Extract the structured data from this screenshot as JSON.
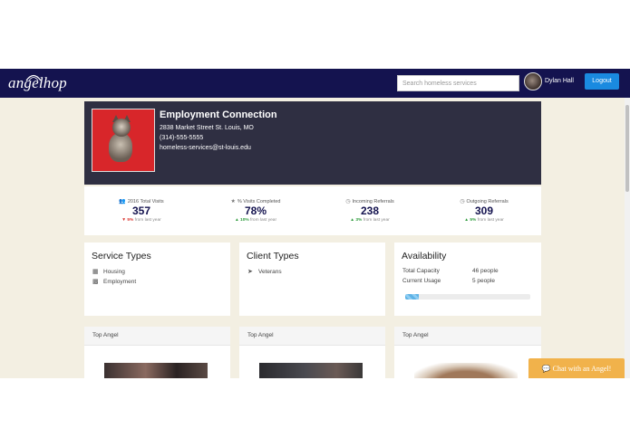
{
  "nav": {
    "logo": "angelhop",
    "search_placeholder": "Search homeless services",
    "user_name": "Dylan Hall",
    "logout": "Logout"
  },
  "profile": {
    "name": "Employment Connection",
    "address": "2838 Market Street St. Louis, MO",
    "phone": "(314)-555-5555",
    "email": "homeless-services@st-louis.edu"
  },
  "stats": [
    {
      "icon": "users-icon",
      "label": "2016 Total Visits",
      "value": "357",
      "direction": "down",
      "change": "5%",
      "suffix": "from last year"
    },
    {
      "icon": "star-icon",
      "label": "% Visits Completed",
      "value": "78%",
      "direction": "up",
      "change": "10%",
      "suffix": "from last year"
    },
    {
      "icon": "clock-icon",
      "label": "Incoming Referrals",
      "value": "238",
      "direction": "up",
      "change": "3%",
      "suffix": "from last year"
    },
    {
      "icon": "clock-icon",
      "label": "Outgoing Referrals",
      "value": "309",
      "direction": "up",
      "change": "5%",
      "suffix": "from last year"
    }
  ],
  "service_types": {
    "title": "Service Types",
    "items": [
      {
        "icon": "building-icon",
        "label": "Housing"
      },
      {
        "icon": "briefcase-icon",
        "label": "Employment"
      }
    ]
  },
  "client_types": {
    "title": "Client Types",
    "items": [
      {
        "icon": "plane-icon",
        "label": "Veterans"
      }
    ]
  },
  "availability": {
    "title": "Availability",
    "capacity_label": "Total Capacity",
    "capacity_value": "46 people",
    "usage_label": "Current Usage",
    "usage_value": "5 people",
    "usage_fraction": 0.11
  },
  "angels": [
    {
      "label": "Top Angel"
    },
    {
      "label": "Top Angel"
    },
    {
      "label": "Top Angel"
    }
  ],
  "chat": {
    "label": "Chat with an Angel!"
  },
  "colors": {
    "navbar": "#14134f",
    "logout": "#1a8ae0",
    "profile_bg": "#2f2f42",
    "page_bg": "#f3efe2",
    "chat": "#f1b24b"
  }
}
